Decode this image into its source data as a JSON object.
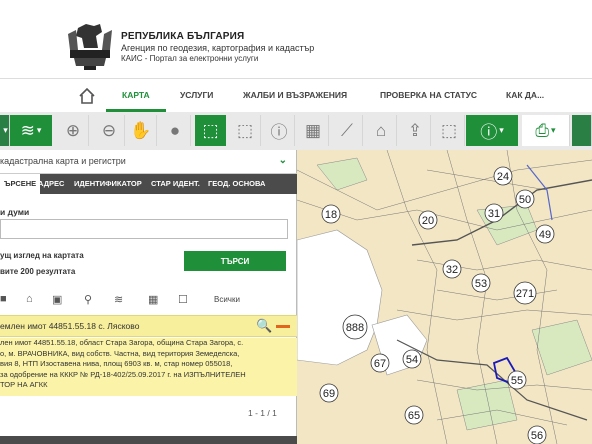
{
  "header": {
    "line1": "РЕПУБЛИКА БЪЛГАРИЯ",
    "line2": "Агенция по геодезия, картография и кадастър",
    "line3": "КАИС - Портал за електронни услуги"
  },
  "nav": {
    "items": [
      "КАРТА",
      "УСЛУГИ",
      "ЖАЛБИ И ВЪЗРАЖЕНИЯ",
      "ПРОВЕРКА НА СТАТУС",
      "КАК ДА..."
    ]
  },
  "toolbar": {
    "icons": [
      "layers-icon",
      "zoom-in-icon",
      "zoom-out-icon",
      "pan-hand-icon",
      "globe-icon",
      "select-rect-icon",
      "select-rect-icon",
      "info-icon",
      "measure-area-icon",
      "ruler-icon",
      "polygon-icon",
      "upload-icon",
      "select-dashed-icon",
      "layer-info-icon",
      "print-icon"
    ]
  },
  "panel": {
    "select_label": "кадастрална карта и регистри",
    "tabs": [
      "ЪРСЕНЕ",
      "АДРЕС",
      "ИДЕНТИФИКАТОР",
      "СТАР ИДЕНТ.",
      "ГЕОД. ОСНОВА"
    ],
    "words_label": "и думи",
    "view_label": "ущ изглед на картата",
    "results_label": "вите 200 резултата",
    "search_button": "ТЪРСИ",
    "filters_all": "Всички",
    "result_title": "емлен имот 44851.55.18 с. Лясково",
    "result_lines": [
      "лен имот 44851.55.18, област Стара Загора, община Стара Загора, с.",
      "о, м. ВРАЧОВНИКА, вид собств. Частна, вид територия Земеделска,",
      "вия 8, НТП Изоставена нива, площ 6903 кв. м, стар номер 055018,",
      "за одобрение на КККР № РД-18-402/25.09.2017 г. на ИЗПЪЛНИТЕЛЕН",
      "ТОР НА АГКК"
    ],
    "pager": "1 - 1 / 1"
  },
  "map": {
    "labels": [
      "24",
      "18",
      "20",
      "31",
      "50",
      "49",
      "32",
      "53",
      "271",
      "888",
      "54",
      "67",
      "55",
      "69",
      "65",
      "56"
    ]
  },
  "colors": {
    "accent": "#1f8f3a",
    "toolbar_bg": "#e9e9e9",
    "result_bg": "#fbf4a8"
  }
}
